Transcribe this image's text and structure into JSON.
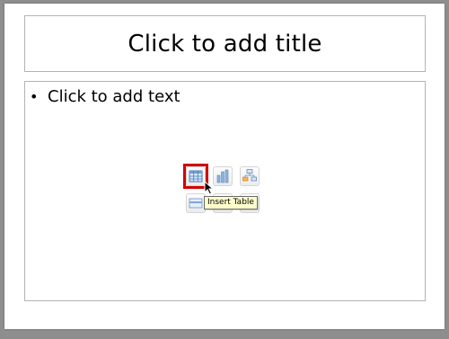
{
  "slide": {
    "title_placeholder": "Click to add title",
    "body_placeholder": "Click to add text",
    "bullet": "•"
  },
  "content_icons": {
    "items": [
      {
        "name": "insert-table-icon",
        "label": "Insert Table"
      },
      {
        "name": "insert-chart-icon"
      },
      {
        "name": "insert-smartart-icon"
      },
      {
        "name": "insert-picture-icon"
      },
      {
        "name": "insert-clip-art-icon"
      },
      {
        "name": "insert-media-icon"
      }
    ],
    "highlight_color": "#d40000"
  },
  "tooltip": {
    "text": "Insert Table",
    "background": "#ffffcc"
  }
}
